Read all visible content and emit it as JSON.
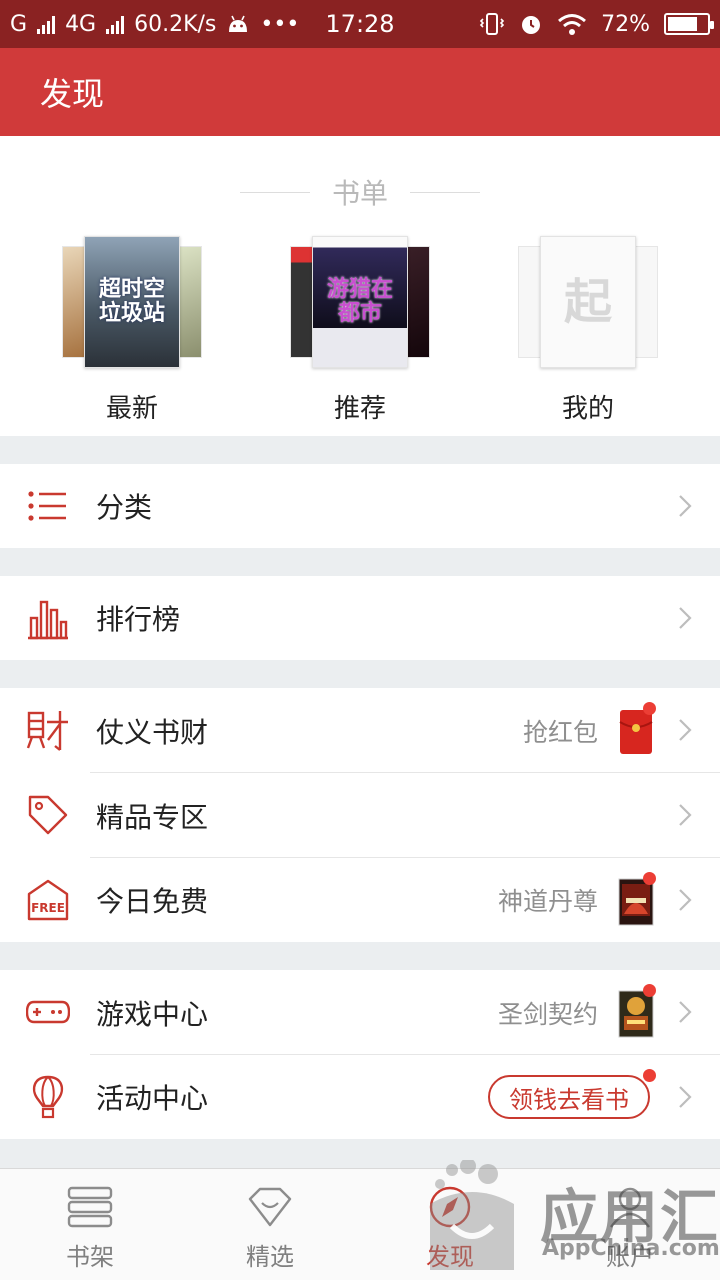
{
  "status_bar": {
    "carrier1": "G",
    "carrier2": "4G",
    "net_speed": "60.2K/s",
    "dots": "•••",
    "time": "17:28",
    "battery": "72%"
  },
  "header": {
    "title": "发现"
  },
  "booklist_section": {
    "title": "书单",
    "items": [
      {
        "label": "最新",
        "cover_text": "超时空垃圾站"
      },
      {
        "label": "推荐",
        "cover_text": "游猎在都市"
      },
      {
        "label": "我的",
        "cover_text": "起"
      }
    ]
  },
  "menu": {
    "category": {
      "title": "分类"
    },
    "ranking": {
      "title": "排行榜"
    },
    "finance": {
      "title": "仗义书财",
      "sub": "抢红包"
    },
    "premium": {
      "title": "精品专区"
    },
    "free_today": {
      "title": "今日免费",
      "sub": "神道丹尊"
    },
    "game_center": {
      "title": "游戏中心",
      "sub": "圣剑契约"
    },
    "activity": {
      "title": "活动中心",
      "sub": "领钱去看书"
    }
  },
  "tabs": [
    {
      "label": "书架"
    },
    {
      "label": "精选"
    },
    {
      "label": "发现"
    },
    {
      "label": "账户"
    }
  ],
  "watermark": {
    "text": "应用汇",
    "sub": "AppChina.com"
  },
  "colors": {
    "accent": "#d03a3a",
    "status_bar": "#8a2222",
    "red_dot": "#ec3e35"
  }
}
